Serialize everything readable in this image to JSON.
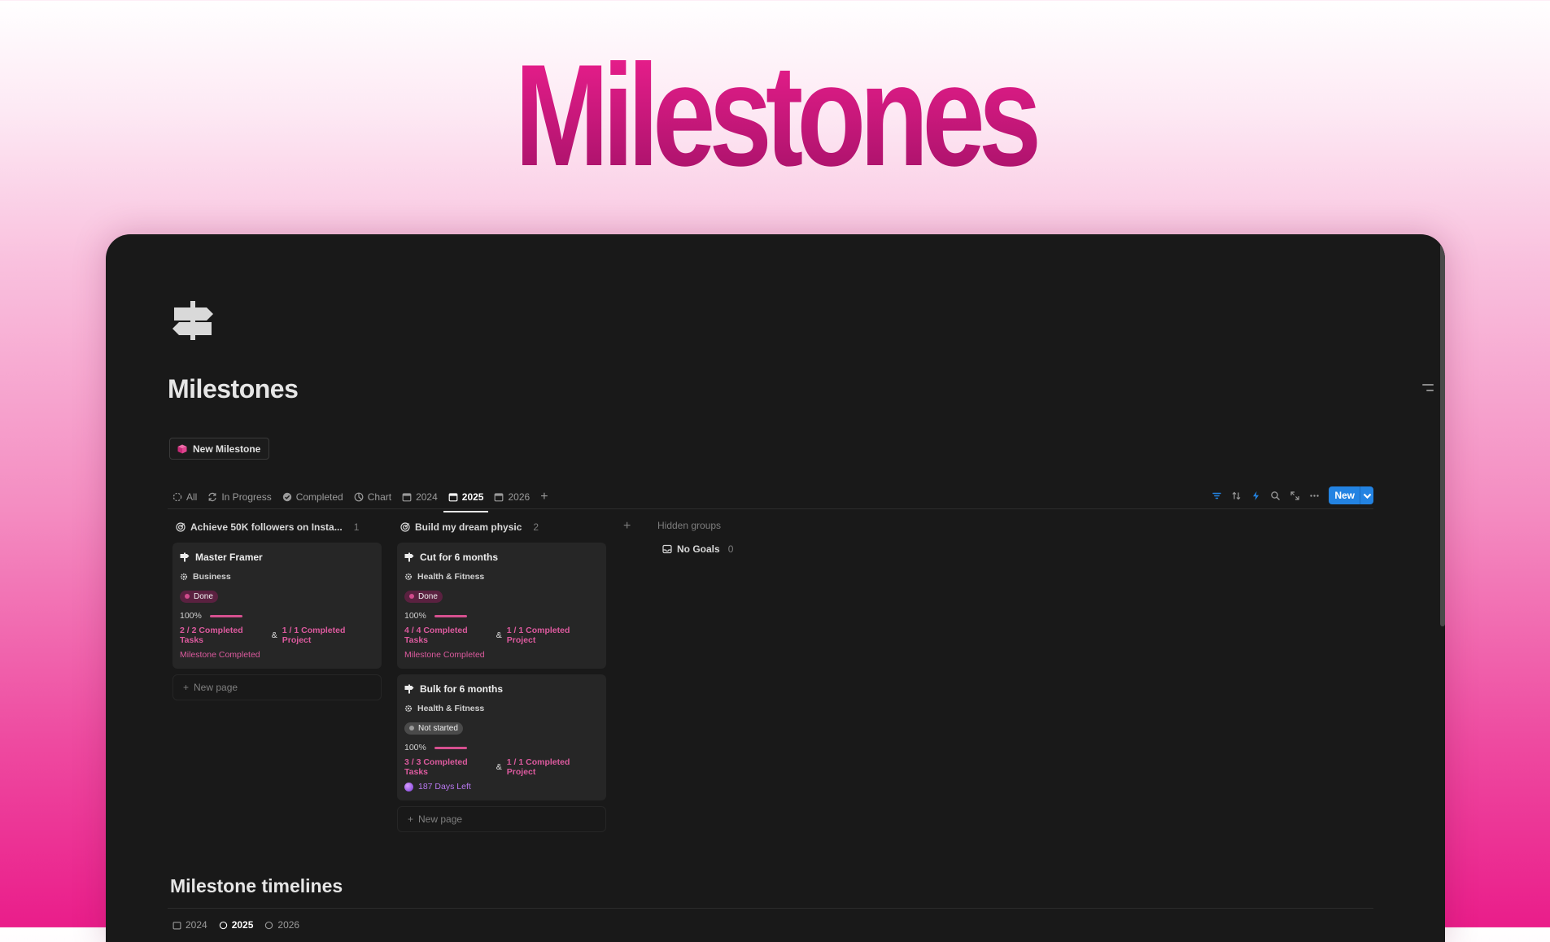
{
  "hero": {
    "title": "Milestones"
  },
  "page": {
    "title": "Milestones",
    "new_milestone_label": "New Milestone"
  },
  "tabs": [
    {
      "label": "All",
      "icon": "circle-dashed-icon"
    },
    {
      "label": "In Progress",
      "icon": "refresh-icon"
    },
    {
      "label": "Completed",
      "icon": "badge-check-icon"
    },
    {
      "label": "Chart",
      "icon": "pie-chart-icon"
    },
    {
      "label": "2024",
      "icon": "calendar-icon"
    },
    {
      "label": "2025",
      "icon": "calendar-icon",
      "active": true
    },
    {
      "label": "2026",
      "icon": "calendar-icon"
    }
  ],
  "toolbar": {
    "new_label": "New"
  },
  "columns": [
    {
      "title": "Achieve 50K followers on Insta...",
      "count": "1",
      "cards": [
        {
          "title": "Master Framer",
          "category": "Business",
          "status": "Done",
          "progress": "100%",
          "progress_value": 1.0,
          "tasks": "2 / 2 Completed Tasks",
          "amp": "&",
          "projects": "1 / 1 Completed Project",
          "footer": "Milestone Completed"
        }
      ],
      "new_page": "New page"
    },
    {
      "title": "Build my dream physic",
      "count": "2",
      "cards": [
        {
          "title": "Cut for 6 months",
          "category": "Health & Fitness",
          "status": "Done",
          "progress": "100%",
          "progress_value": 1.0,
          "tasks": "4 / 4 Completed Tasks",
          "amp": "&",
          "projects": "1 / 1 Completed Project",
          "footer": "Milestone Completed"
        },
        {
          "title": "Bulk for 6 months",
          "category": "Health & Fitness",
          "status": "Not started",
          "progress": "100%",
          "progress_value": 1.0,
          "tasks": "3 / 3 Completed Tasks",
          "amp": "&",
          "projects": "1 / 1 Completed Project",
          "footer": "187 Days Left"
        }
      ],
      "new_page": "New page"
    }
  ],
  "hidden_groups": {
    "label": "Hidden groups",
    "no_goals_label": "No Goals",
    "no_goals_count": "0"
  },
  "timelines": {
    "title": "Milestone timelines",
    "tabs": [
      {
        "label": "2024"
      },
      {
        "label": "2025",
        "active": true
      },
      {
        "label": "2026"
      }
    ]
  },
  "colors": {
    "accent_pink": "#dc5a9e",
    "new_button_blue": "#2383e2",
    "window_bg": "#191919"
  }
}
